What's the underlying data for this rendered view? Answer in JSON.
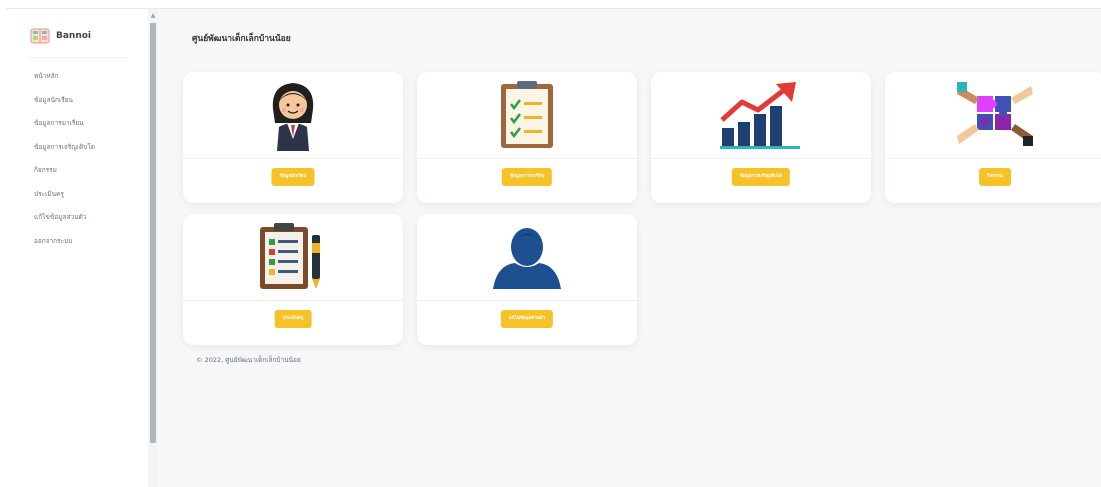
{
  "app": {
    "name": "Bannoi"
  },
  "sidebar": {
    "items": [
      {
        "label": "หน้าหลัก"
      },
      {
        "label": "ข้อมูลนักเรียน"
      },
      {
        "label": "ข้อมูลการมาเรียน"
      },
      {
        "label": "ข้อมูลการเจริญเติบโต"
      },
      {
        "label": "กิจกรรม"
      },
      {
        "label": "ประเมินครู"
      },
      {
        "label": "แก้ไขข้อมูลส่วนตัว"
      },
      {
        "label": "ออกจากระบบ"
      }
    ]
  },
  "main": {
    "title": "ศูนย์พัฒนาเด็กเล็กบ้านน้อย",
    "cards": [
      {
        "icon": "student-icon",
        "button": "ข้อมูลนักเรียน"
      },
      {
        "icon": "checklist-icon",
        "button": "ข้อมูลการมาเรียน"
      },
      {
        "icon": "growth-chart-icon",
        "button": "ข้อมูลการเจริญเติบโต"
      },
      {
        "icon": "puzzle-hands-icon",
        "button": "กิจกรรม"
      },
      {
        "icon": "clipboard-pen-icon",
        "button": "ประเมินครู"
      },
      {
        "icon": "user-profile-icon",
        "button": "แก้ไขข้อมูลส่วนตัว"
      }
    ]
  },
  "footer": {
    "text": "© 2022, ศูนย์พัฒนาเด็กเล็กบ้านน้อย"
  },
  "colors": {
    "accent": "#f6c227",
    "background": "#f6f7f9"
  }
}
